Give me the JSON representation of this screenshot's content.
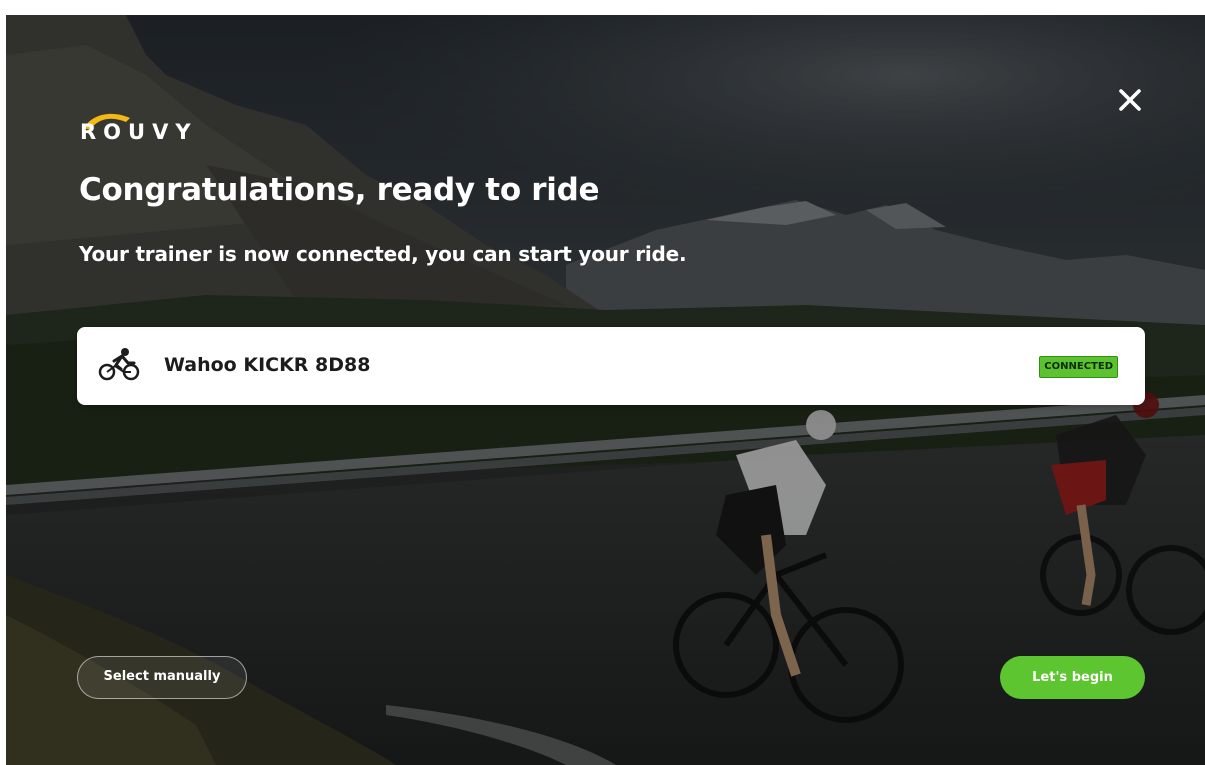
{
  "brand": {
    "logo_text": "ROUVY",
    "accent_color": "#f5b916"
  },
  "dialog": {
    "close_icon": "close-icon",
    "title": "Congratulations, ready to ride",
    "subtitle": "Your trainer is now connected, you can start your ride."
  },
  "device": {
    "icon": "cyclist-icon",
    "name": "Wahoo KICKR 8D88",
    "status": "CONNECTED",
    "status_color": "#5dc22f"
  },
  "actions": {
    "select_manually_label": "Select manually",
    "begin_label": "Let's begin",
    "begin_color": "#5cc52f"
  }
}
